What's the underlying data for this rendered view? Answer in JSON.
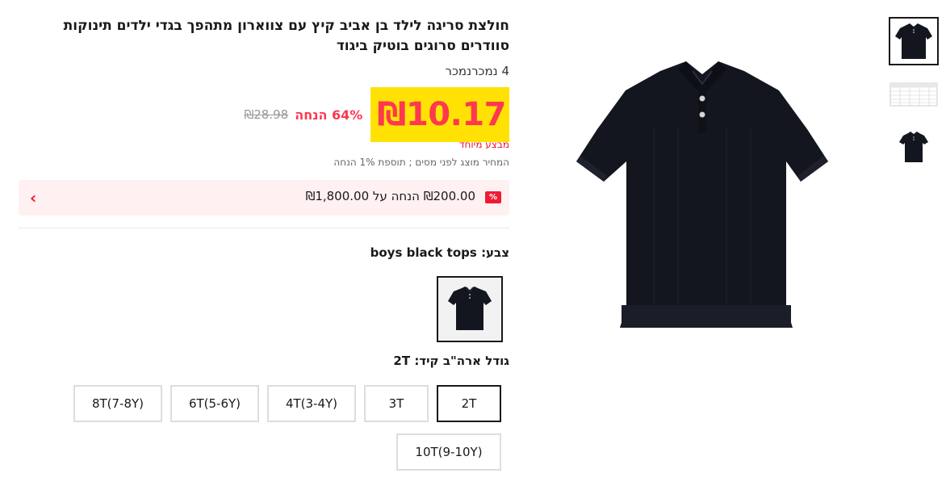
{
  "product": {
    "title": "חולצת סריגה לילד בן אביב קיץ עם צווארון מתהפך בגדי ילדים תינוקות סוודרים סרוגים בוטיק ביגוד",
    "sold": "4 נמכרנמכר",
    "price": "₪10.17",
    "discount": "64% הנחה",
    "original_price": "₪28.98",
    "special_offer": "מבצע מיוחד",
    "tax_note": "המחיר מוצג לפני מסים ; תוספת 1% הנחה"
  },
  "coupon": {
    "icon": "%",
    "text": "₪200.00 הנחה על ₪1,800.00",
    "chevron": "›"
  },
  "color": {
    "label": "צבע:",
    "value": "boys black tops"
  },
  "size": {
    "label": "גודל ארה\"ב קיד:",
    "value": "2T",
    "options": [
      "2T",
      "3T",
      "4T(3-4Y)",
      "6T(5-6Y)",
      "8T(7-8Y)",
      "10T(9-10Y)"
    ],
    "selected_index": 0
  },
  "colors": {
    "price_accent": "#fd384f",
    "price_highlight": "#ffe203",
    "coupon_bg": "#fff0f2",
    "garment": "#14161f"
  }
}
